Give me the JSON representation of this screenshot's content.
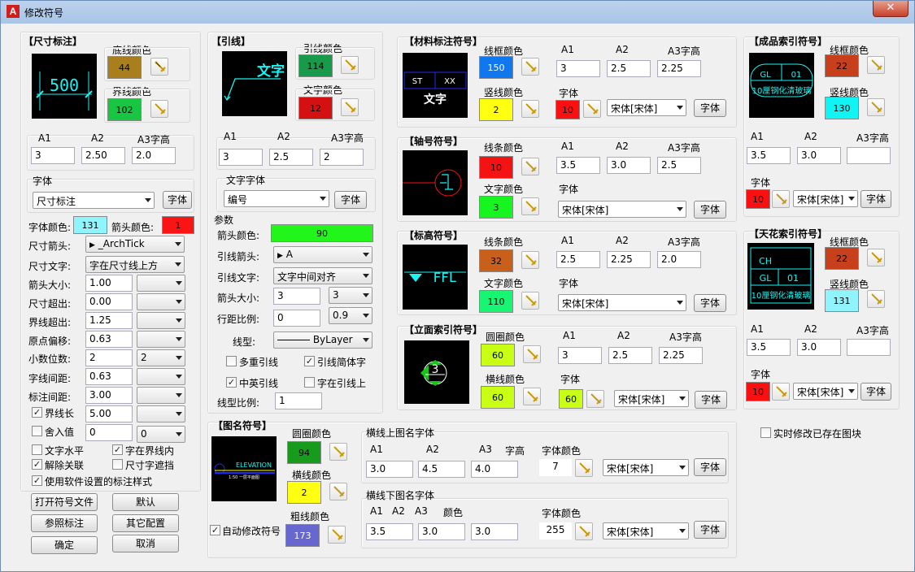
{
  "window": {
    "title": "修改符号",
    "close": "✕"
  },
  "dim": {
    "legend": "【尺寸标注】",
    "base_color_label": "底线颜色",
    "base_color": {
      "value": "44",
      "hex": "#a87f1c"
    },
    "ext_color_label": "界线颜色",
    "ext_color": {
      "value": "102",
      "hex": "#19c644"
    },
    "preview_text": "500",
    "a1_label": "A1",
    "a2_label": "A2",
    "a3_label": "A3字高",
    "a1": "3",
    "a2": "2.50",
    "a3": "2.0",
    "font_group": "字体",
    "font_value": "尺寸标注",
    "font_btn": "字体",
    "text_color_label": "字体颜色:",
    "text_color": {
      "value": "131",
      "hex": "#8ff4fd"
    },
    "arrow_color_label": "箭头颜色:",
    "arrow_color": {
      "value": "1",
      "hex": "#fa1515"
    },
    "arrow_label": "尺寸箭头:",
    "arrow_value": "_ArchTick",
    "text_label": "尺寸文字:",
    "text_value": "字在尺寸线上方",
    "arrow_size_label": "箭头大小:",
    "arrow_size": "1.00",
    "overshoot_label": "尺寸超出:",
    "overshoot": "0.00",
    "ext_over_label": "界线超出:",
    "ext_over": "1.25",
    "origin_label": "原点偏移:",
    "origin": "0.63",
    "decimal_label": "小数位数:",
    "decimal": "2",
    "decimal_sel": "2",
    "char_gap_label": "字线间距:",
    "char_gap": "0.63",
    "dim_gap_label": "标注间距:",
    "dim_gap": "3.00",
    "ext_len_label": "界线长",
    "ext_len": "5.00",
    "round_label": "舍入值",
    "round": "0",
    "round_sel": "0",
    "cb_text_horiz": "文字水平",
    "cb_text_in_ext": "字在界线内",
    "cb_unassoc": "解除关联",
    "cb_mask": "尺寸字遮挡",
    "cb_use_soft": "使用软件设置的标注样式"
  },
  "buttons": {
    "open_file": "打开符号文件",
    "default": "默认",
    "ref_dim": "参照标注",
    "other_cfg": "其它配置",
    "ok": "确定",
    "cancel": "取消"
  },
  "leader": {
    "legend": "【引线】",
    "line_color_label": "引线颜色",
    "line_color": {
      "value": "114",
      "hex": "#179b4a"
    },
    "text_color_label": "文字颜色",
    "text_color": {
      "value": "12",
      "hex": "#d41010"
    },
    "preview_text": "文字",
    "a1_label": "A1",
    "a2_label": "A2",
    "a3_label": "A3字高",
    "a1": "3",
    "a2": "2.5",
    "a3": "2",
    "font_group": "文字字体",
    "font_value": "编号",
    "font_btn": "字体",
    "params_label": "参数",
    "arrow_color_label": "箭头颜色:",
    "arrow_color": {
      "value": "90",
      "hex": "#22f51a"
    },
    "arrow_label": "引线箭头:",
    "arrow_value": "A",
    "text_label": "引线文字:",
    "text_value": "文字中间对齐",
    "arrow_size_label": "箭头大小:",
    "arrow_size": "3",
    "arrow_size_sel": "3",
    "spacing_label": "行距比例:",
    "spacing": "0",
    "spacing_sel": "0.9",
    "linetype_label": "线型:",
    "linetype_value": "ByLayer",
    "cb_multi": "多重引线",
    "cb_simplified": "引线简体字",
    "cb_cn_en": "中英引线",
    "cb_on_leader": "字在引线上",
    "lt_scale_label": "线型比例:",
    "lt_scale": "1"
  },
  "material": {
    "legend": "【材料标注符号】",
    "frame_color_label": "线框颜色",
    "frame_color": {
      "value": "150",
      "hex": "#1177ef"
    },
    "vline_color_label": "竖线颜色",
    "vline_color": {
      "value": "2",
      "hex": "#ffff12"
    },
    "a1_label": "A1",
    "a2_label": "A2",
    "a3_label": "A3字高",
    "a1": "3",
    "a2": "2.5",
    "a3": "2.25",
    "font_label": "字体",
    "font_color": {
      "value": "10",
      "hex": "#fa1010"
    },
    "font_value": "宋体[宋体]",
    "font_btn": "字体",
    "preview_st": "ST",
    "preview_xx": "XX",
    "preview_text": "文字"
  },
  "axis": {
    "legend": "【轴号符号】",
    "line_color_label": "线条颜色",
    "line_color": {
      "value": "10",
      "hex": "#f41212"
    },
    "text_color_label": "文字颜色",
    "text_color": {
      "value": "3",
      "hex": "#17f520"
    },
    "a1_label": "A1",
    "a2_label": "A2",
    "a3_label": "A3字高",
    "a1": "3.5",
    "a2": "3.0",
    "a3": "2.5",
    "font_label": "字体",
    "font_value": "宋体[宋体]",
    "font_btn": "字体"
  },
  "elev": {
    "legend": "【标高符号】",
    "line_color_label": "线条颜色",
    "line_color": {
      "value": "32",
      "hex": "#c8601b"
    },
    "text_color_label": "文字颜色",
    "text_color": {
      "value": "110",
      "hex": "#17f572"
    },
    "a1_label": "A1",
    "a2_label": "A2",
    "a3_label": "A3字高",
    "a1": "2.5",
    "a2": "2.25",
    "a3": "2.0",
    "font_label": "字体",
    "font_value": "宋体[宋体]",
    "font_btn": "字体",
    "preview_text": "FFL"
  },
  "facade": {
    "legend": "【立面索引符号】",
    "circle_color_label": "圆圈颜色",
    "circle_color": {
      "value": "60",
      "hex": "#c8ff14"
    },
    "hline_color_label": "横线颜色",
    "hline_color": {
      "value": "60",
      "hex": "#c8ff14"
    },
    "a1_label": "A1",
    "a2_label": "A2",
    "a3_label": "A3字高",
    "a1": "3",
    "a2": "2.5",
    "a3": "2.25",
    "font_label": "字体",
    "font_color": {
      "value": "60",
      "hex": "#c8ff14"
    },
    "font_value": "宋体[宋体]",
    "font_btn": "字体",
    "preview_num": "3"
  },
  "title_sym": {
    "legend": "【图名符号】",
    "circle_color_label": "圆圈颜色",
    "circle_color": {
      "value": "94",
      "hex": "#179b1c"
    },
    "hline_color_label": "横线颜色",
    "hline_color": {
      "value": "2",
      "hex": "#ffff12"
    },
    "thick_color_label": "粗线颜色",
    "thick_color": {
      "value": "173",
      "hex": "#6867d0"
    },
    "auto_label": "自动修改符号",
    "preview_text": "ELEVATION",
    "preview_sub": "1:50 一层平面图",
    "upper_label": "横线上图名字体",
    "upper_a1_label": "A1",
    "upper_a2_label": "A2",
    "upper_a3_label": "A3",
    "upper_h_label": "字高",
    "upper_a1": "3.0",
    "upper_a2": "4.5",
    "upper_a3": "4.0",
    "upper_color_label": "字体颜色",
    "upper_color": "7",
    "upper_font": "宋体[宋体]",
    "upper_btn": "字体",
    "lower_label": "横线下图名字体",
    "lower_a1_label": "A1",
    "lower_a2_label": "A2",
    "lower_a3_label": "A3",
    "lower_c_label": "颜色",
    "lower_a1": "3.5",
    "lower_a2": "3.0",
    "lower_a3": "3.0",
    "lower_color_label": "字体颜色",
    "lower_color": "255",
    "lower_font": "宋体[宋体]",
    "lower_btn": "字体"
  },
  "product": {
    "legend": "【成品索引符号】",
    "frame_color_label": "线框颜色",
    "frame_color": {
      "value": "22",
      "hex": "#c8401b"
    },
    "vline_color_label": "竖线颜色",
    "vline_color": {
      "value": "130",
      "hex": "#10f4f4"
    },
    "a1_label": "A1",
    "a2_label": "A2",
    "a3_label": "A3字高",
    "a1": "3.5",
    "a2": "3.0",
    "a3": "",
    "font_label": "字体",
    "font_color": {
      "value": "10",
      "hex": "#fa1010"
    },
    "font_value": "宋体[宋体]",
    "font_btn": "字体",
    "preview_gl": "GL",
    "preview_num": "01",
    "preview_text": "10厘钢化清玻璃"
  },
  "ceiling": {
    "legend": "【天花索引符号】",
    "frame_color_label": "线框颜色",
    "frame_color": {
      "value": "22",
      "hex": "#c8401b"
    },
    "vline_color_label": "竖线颜色",
    "vline_color": {
      "value": "131",
      "hex": "#8ff4fd"
    },
    "a1_label": "A1",
    "a2_label": "A2",
    "a3_label": "A3字高",
    "a1": "3.5",
    "a2": "3.0",
    "a3": "",
    "font_label": "字体",
    "font_color": {
      "value": "10",
      "hex": "#fa1010"
    },
    "font_value": "宋体[宋体]",
    "font_btn": "字体",
    "preview_ch": "CH",
    "preview_gl": "GL",
    "preview_num": "01",
    "preview_text": "10厘钢化清玻璃"
  },
  "realtime": {
    "label": "实时修改已存在图块"
  }
}
